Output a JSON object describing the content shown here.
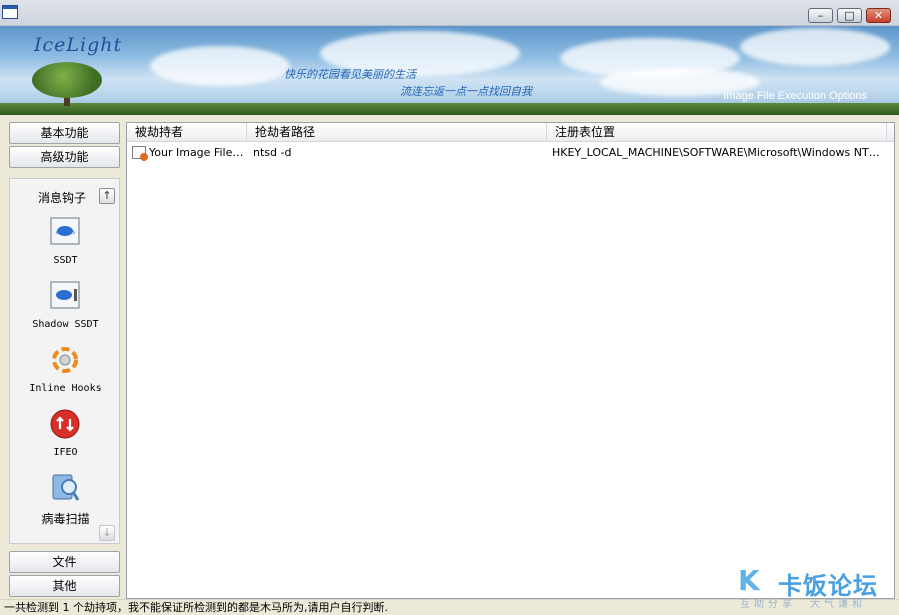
{
  "window": {
    "minimize_glyph": "–",
    "maximize_glyph": "□",
    "close_glyph": "✕"
  },
  "banner": {
    "logo": "IceLight",
    "slogan_line1": "快乐的花园看见美丽的生活",
    "slogan_line2": "流连忘返一点一点找回自我",
    "caption": "Image File Execution Options"
  },
  "sidebar": {
    "top_buttons": [
      "基本功能",
      "高级功能"
    ],
    "category_title": "消息钩子",
    "scroll_up": "↑",
    "scroll_down": "↓",
    "tools": [
      {
        "label": "SSDT",
        "icon": "ssdt-icon"
      },
      {
        "label": "Shadow SSDT",
        "icon": "shadow-ssdt-icon"
      },
      {
        "label": "Inline Hooks",
        "icon": "inline-hooks-icon"
      },
      {
        "label": "IFEO",
        "icon": "ifeo-icon"
      },
      {
        "label": "病毒扫描",
        "icon": "virus-scan-icon"
      }
    ],
    "bottom_buttons": [
      "文件",
      "其他"
    ]
  },
  "list": {
    "columns": [
      "被劫持者",
      "抢劫者路径",
      "注册表位置"
    ],
    "rows": [
      {
        "target": "Your Image File N...",
        "hijacker_path": "ntsd -d",
        "registry": "HKEY_LOCAL_MACHINE\\SOFTWARE\\Microsoft\\Windows NT\\Curr..."
      }
    ]
  },
  "status": {
    "text": "一共检测到 1 个劫持项，我不能保证所检测到的都是木马所为,请用户自行判断."
  },
  "watermark": {
    "mark": "K",
    "text": "卡饭论坛",
    "sub": "互助分享　大气谦和"
  },
  "colors": {
    "accent": "#2466b5",
    "close_button": "#c5402a",
    "watermark": "#4a9fe0"
  }
}
